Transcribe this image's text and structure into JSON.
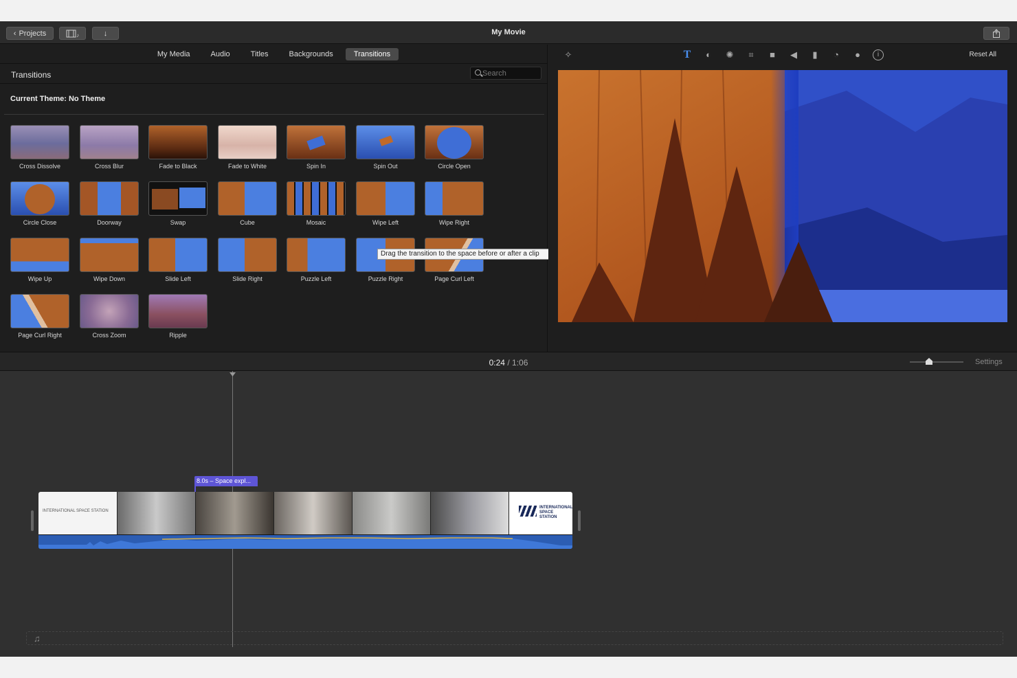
{
  "window": {
    "title": "My Movie",
    "projects_label": "Projects"
  },
  "browser": {
    "tabs": [
      "My Media",
      "Audio",
      "Titles",
      "Backgrounds",
      "Transitions"
    ],
    "active_tab": "Transitions",
    "section_title": "Transitions",
    "search_placeholder": "Search",
    "current_theme": "Current Theme: No Theme",
    "transitions": [
      "Cross Dissolve",
      "Cross Blur",
      "Fade to Black",
      "Fade to White",
      "Spin In",
      "Spin Out",
      "Circle Open",
      "Circle Close",
      "Doorway",
      "Swap",
      "Cube",
      "Mosaic",
      "Wipe Left",
      "Wipe Right",
      "Wipe Up",
      "Wipe Down",
      "Slide Left",
      "Slide Right",
      "Puzzle Left",
      "Puzzle Right",
      "Page Curl Left",
      "Page Curl Right",
      "Cross Zoom",
      "Ripple"
    ],
    "tooltip": "Drag the transition to the space before or after a clip"
  },
  "viewer": {
    "tools": [
      "magic-wand",
      "title-T",
      "color-balance",
      "color-correction",
      "crop",
      "stabilization",
      "volume",
      "noise-reduction",
      "speed",
      "clip-filter",
      "info"
    ],
    "reset_label": "Reset All"
  },
  "timeline": {
    "current_time": "0:24",
    "separator": "/",
    "total_time": "1:06",
    "settings_label": "Settings",
    "clip_label": "8.0s – Space expl...",
    "first_frame_text": "INTERNATIONAL SPACE STATION",
    "last_frame_text": "INTERNATIONAL SPACE STATION"
  },
  "colors": {
    "accent": "#5e55d6",
    "audio": "#2c5db3"
  }
}
